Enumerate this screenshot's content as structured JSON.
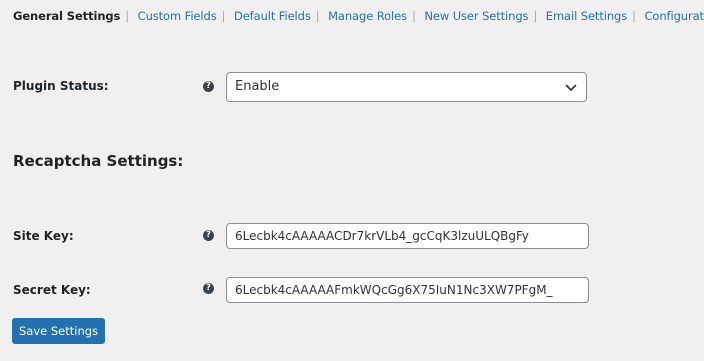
{
  "nav": {
    "items": [
      {
        "label": "General Settings",
        "current": true
      },
      {
        "label": "Custom Fields",
        "current": false
      },
      {
        "label": "Default Fields",
        "current": false
      },
      {
        "label": "Manage Roles",
        "current": false
      },
      {
        "label": "New User Settings",
        "current": false
      },
      {
        "label": "Email Settings",
        "current": false
      },
      {
        "label": "Configuration",
        "current": false
      }
    ],
    "separator": "|"
  },
  "plugin_status": {
    "label": "Plugin Status:",
    "help_icon": "?",
    "selected": "Enable"
  },
  "recaptcha": {
    "title": "Recaptcha Settings:",
    "site_key": {
      "label": "Site Key:",
      "help_icon": "?",
      "value": "6Lecbk4cAAAAACDr7krVLb4_gcCqK3lzuULQBgFy"
    },
    "secret_key": {
      "label": "Secret Key:",
      "help_icon": "?",
      "value": "6Lecbk4cAAAAAFmkWQcGg6X75IuN1Nc3XW7PFgM_"
    }
  },
  "actions": {
    "save_label": "Save Settings"
  },
  "colors": {
    "accent": "#2271b1",
    "background": "#f0f0f1",
    "text": "#1d2327"
  }
}
